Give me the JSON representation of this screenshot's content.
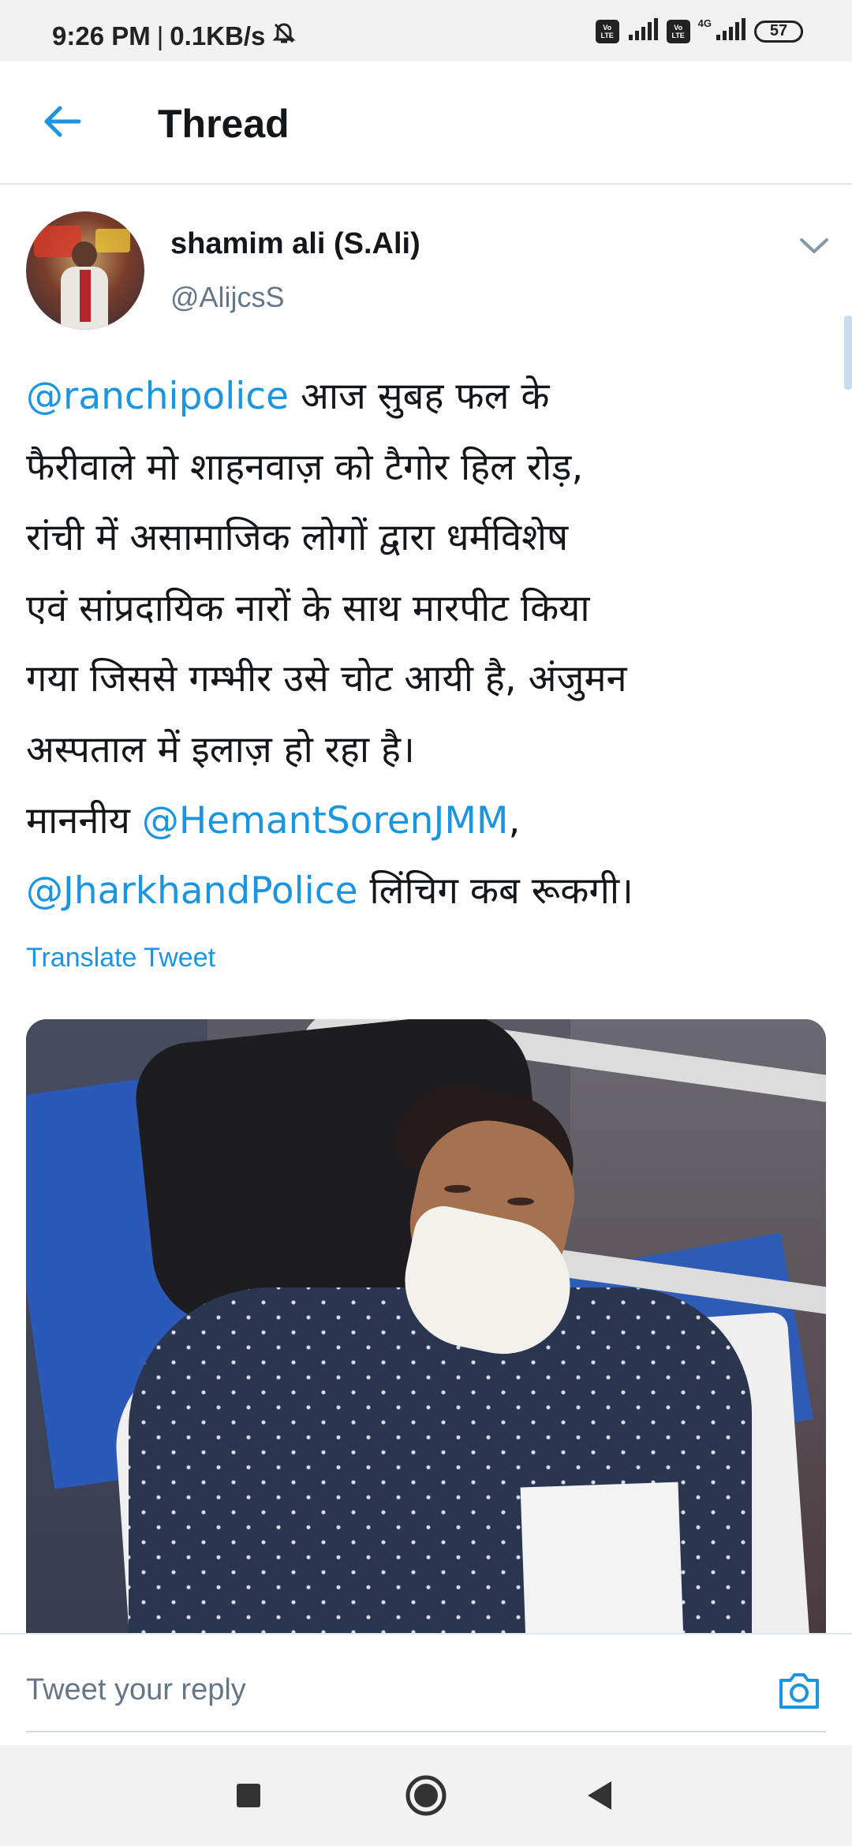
{
  "status_bar": {
    "time": "9:26 PM",
    "separator": "|",
    "network_speed": "0.1KB/s",
    "volte_1": "Vo LTE",
    "volte_2": "Vo LTE",
    "network_type": "4G",
    "battery": "57",
    "icons": [
      "mute-icon",
      "volte-icon",
      "signal-icon",
      "volte-icon",
      "signal-icon",
      "battery-icon"
    ]
  },
  "header": {
    "title": "Thread",
    "back_icon": "arrow-left-icon",
    "accent_color": "#1b95e0"
  },
  "tweet": {
    "author_name": "shamim ali (S.Ali)",
    "author_handle": "@AlijcsS",
    "menu_icon": "chevron-down-icon",
    "text": {
      "mention_1": "@ranchipolice",
      "line_1": " आज सुबह फल के",
      "line_2": "फैरीवाले मो शाहनवाज़ को टैगोर हिल रोड़,",
      "line_3": "रांची में असामाजिक लोगों द्वारा धर्मविशेष",
      "line_4": "एवं सांप्रदायिक नारों के साथ मारपीट किया",
      "line_5": "गया जिससे गम्भीर उसे चोट आयी है, अंजुमन",
      "line_6": "अस्पताल में इलाज़ हो रहा है।",
      "line_7_prefix": "माननीय ",
      "mention_2": "@HemantSorenJMM",
      "line_7_suffix": ",",
      "mention_3": "@JharkhandPolice",
      "line_8_suffix": " लिंचिग कब रूकगी।"
    },
    "translate_label": "Translate Tweet"
  },
  "reply_bar": {
    "placeholder": "Tweet your reply",
    "camera_icon": "camera-icon"
  },
  "nav_bar": {
    "icons": [
      "recents-square-icon",
      "home-circle-icon",
      "back-triangle-icon"
    ]
  }
}
